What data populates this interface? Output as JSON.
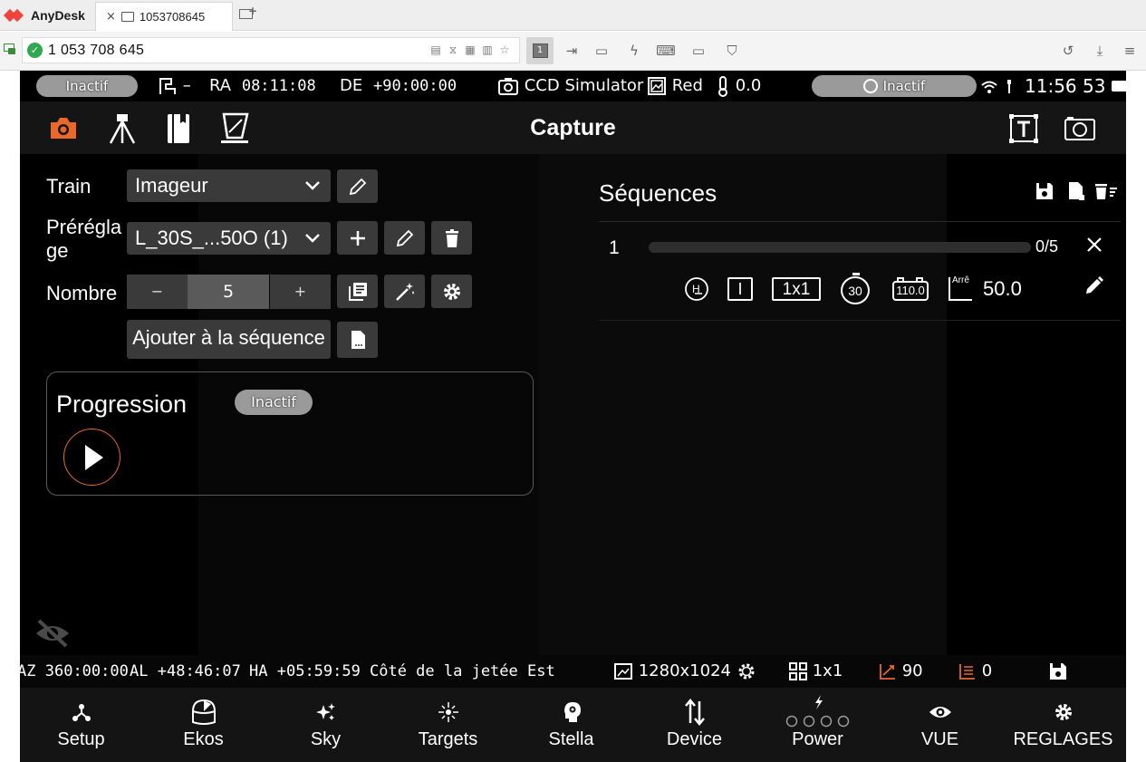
{
  "anydesk": {
    "brand": "AnyDesk",
    "tab_title": "1053708645",
    "tab_close": "×",
    "address": "1 053 708 645",
    "active_tool_label": "1"
  },
  "status": {
    "left_pill": "Inactif",
    "mount_dash": "–",
    "ra_label": "RA",
    "ra_value": "08:11:08",
    "de_label": "DE",
    "de_value": "+90:00:00",
    "camera": "CCD Simulator",
    "filter": "Red",
    "temperature": "0.0",
    "right_pill": "Inactif",
    "time": "11:56 53"
  },
  "module": {
    "title": "Capture"
  },
  "form": {
    "train_label": "Train",
    "train_value": "Imageur",
    "preset_label": "Préréglage",
    "preset_value": "L_30S_...50O (1)",
    "count_label": "Nombre",
    "count_minus": "−",
    "count_value": "5",
    "count_plus": "+",
    "add_sequence": "Ajouter à la séquence"
  },
  "progress": {
    "title": "Progression",
    "status": "Inactif"
  },
  "sequences": {
    "title": "Séquences",
    "items": [
      {
        "index": "1",
        "progress": 0.0,
        "count": "0/5",
        "filter_box": "I",
        "binning": "1x1",
        "timer": "30",
        "camera_temp": "110.0",
        "stop_label": "Arrê",
        "stop_value": "50.0"
      }
    ]
  },
  "info": {
    "az_label": "AZ",
    "az_value": "360:00:00",
    "al_label": "AL",
    "al_value": "+48:46:07",
    "ha_label": "HA",
    "ha_value": "+05:59:59",
    "pier_side": "Côté de la jetée Est",
    "resolution": "1280x1024",
    "binning": "1x1",
    "gain": "90",
    "offset": "0"
  },
  "nav": {
    "items": [
      {
        "label": "Setup"
      },
      {
        "label": "Ekos"
      },
      {
        "label": "Sky"
      },
      {
        "label": "Targets"
      },
      {
        "label": "Stella"
      },
      {
        "label": "Device"
      },
      {
        "label": "Power"
      },
      {
        "label": "VUE"
      },
      {
        "label": "REGLAGES"
      }
    ]
  },
  "colors": {
    "accent": "#e8692a",
    "pill": "#9a9a9a",
    "field": "#3a3a3a",
    "anydesk_red": "#ef443b",
    "connected_green": "#2fa84f"
  }
}
